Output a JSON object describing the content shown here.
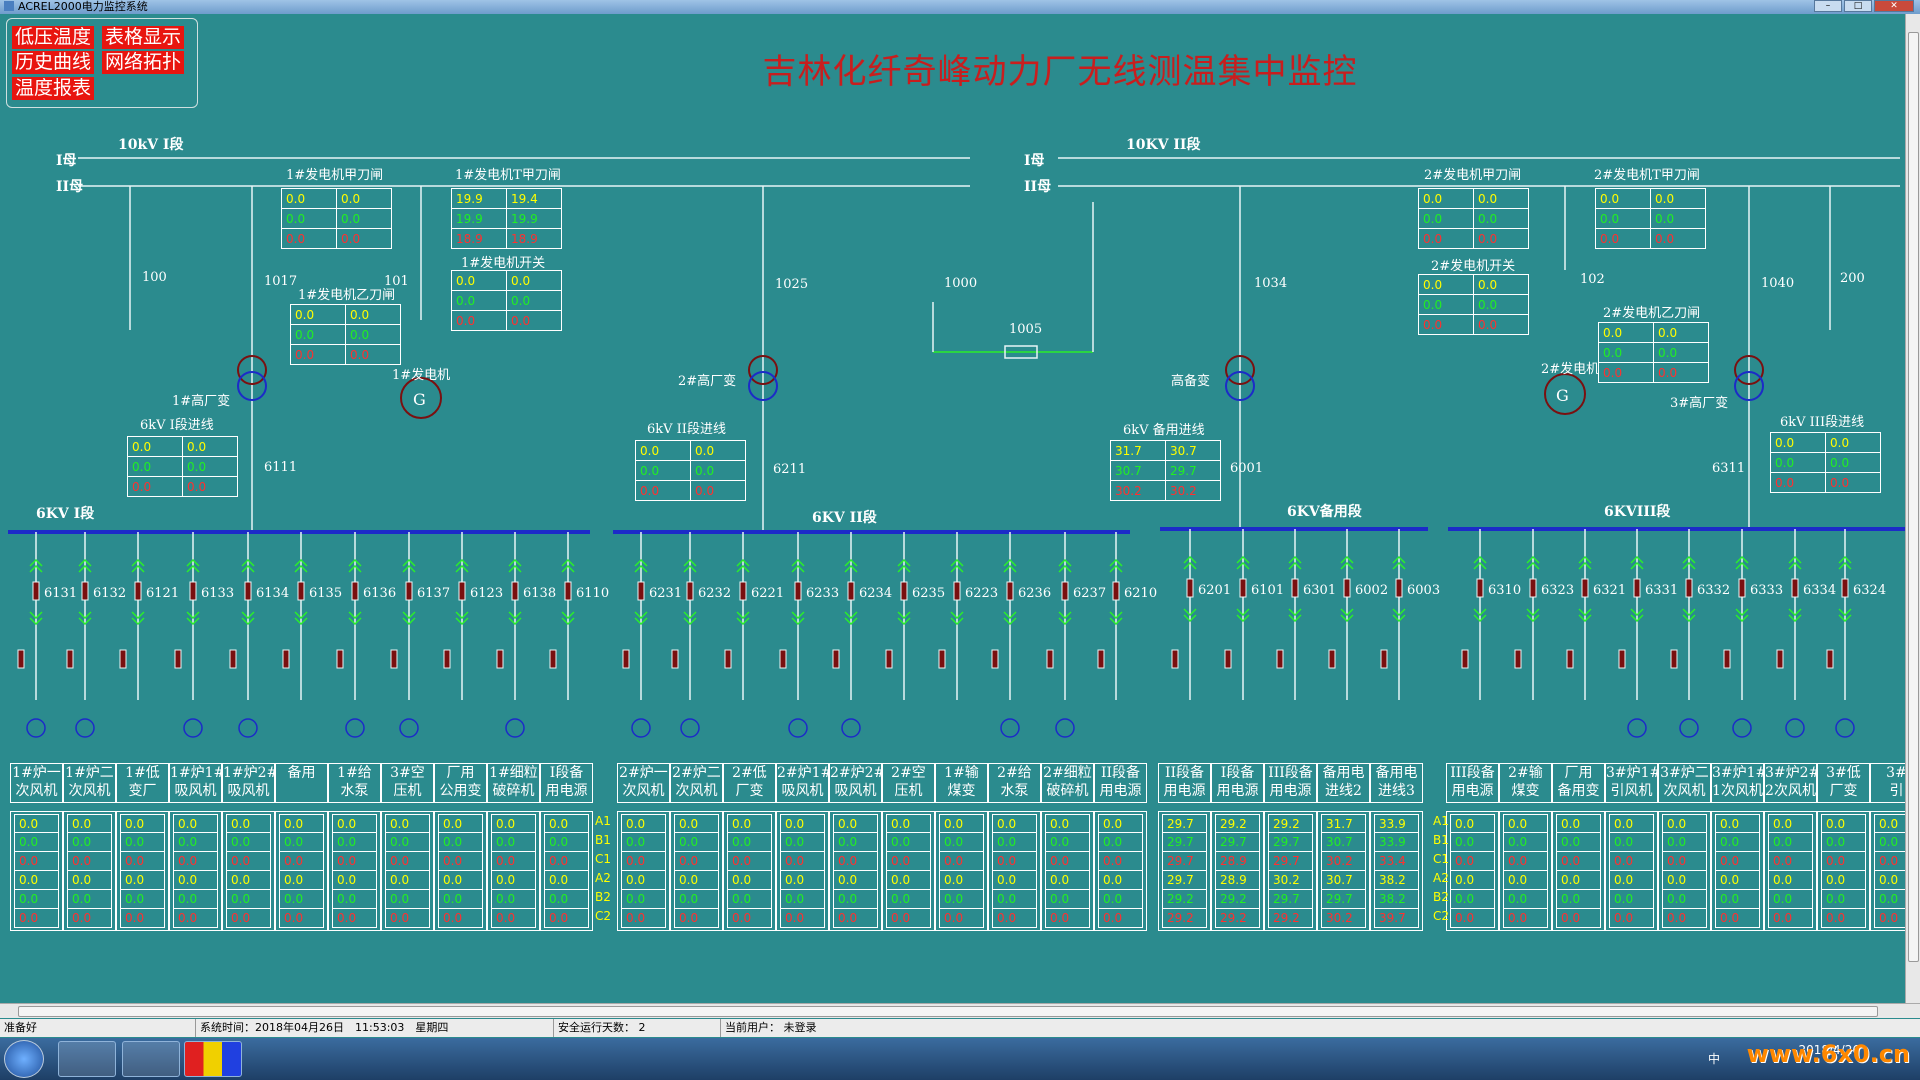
{
  "window": {
    "title": "ACREL2000电力监控系统"
  },
  "menu": {
    "btn1": "低压温度",
    "btn2": "表格显示",
    "btn3": "历史曲线",
    "btn4": "网络拓扑",
    "btn5": "温度报表"
  },
  "page_title": "吉林化纤奇峰动力厂无线测温集中监控",
  "bus": {
    "i_mu_l": "I母",
    "ii_mu_l": "II母",
    "i_mu_r": "I母",
    "ii_mu_r": "II母",
    "kv10_1": "10kV I段",
    "kv10_2": "10KV II段",
    "kv6_1": "6KV I段",
    "kv6_2": "6KV II段",
    "kv6_bk": "6KV备用段",
    "kv6_3": "6KVIII段"
  },
  "labels": {
    "gen1a": "1#发电机甲刀闸",
    "gen1t": "1#发电机T甲刀闸",
    "gen1sw": "1#发电机开关",
    "gen1b": "1#发电机乙刀闸",
    "gen1": "1#发电机",
    "hf1": "1#高厂变",
    "in6_1": "6kV I段进线",
    "hf2": "2#高厂变",
    "in6_2": "6kV II段进线",
    "gen2a": "2#发电机甲刀闸",
    "gen2t": "2#发电机T甲刀闸",
    "gen2sw": "2#发电机开关",
    "gen2b": "2#发电机乙刀闸",
    "gen2": "2#发电机",
    "hbb": "高备变",
    "in6_bk": "6kV 备用进线",
    "hf3": "3#高厂变",
    "in6_3": "6kV III段进线",
    "n100": "100",
    "n1017": "1017",
    "n101": "101",
    "n1025": "1025",
    "n1000": "1000",
    "n1005": "1005",
    "n1034": "1034",
    "n102": "102",
    "n1040": "1040",
    "n200": "200",
    "n6111": "6111",
    "n6211": "6211",
    "n6001": "6001",
    "n6311": "6311",
    "G": "G"
  },
  "tables": {
    "t_gen1a": [
      [
        "0.0",
        "0.0"
      ],
      [
        "0.0",
        "0.0"
      ],
      [
        "0.0",
        "0.0"
      ]
    ],
    "t_gen1t": [
      [
        "19.9",
        "19.4"
      ],
      [
        "19.9",
        "19.9"
      ],
      [
        "18.9",
        "18.9"
      ]
    ],
    "t_gen1sw": [
      [
        "0.0",
        "0.0"
      ],
      [
        "0.0",
        "0.0"
      ],
      [
        "0.0",
        "0.0"
      ]
    ],
    "t_gen1b": [
      [
        "0.0",
        "0.0"
      ],
      [
        "0.0",
        "0.0"
      ],
      [
        "0.0",
        "0.0"
      ]
    ],
    "t_in6_1": [
      [
        "0.0",
        "0.0"
      ],
      [
        "0.0",
        "0.0"
      ],
      [
        "0.0",
        "0.0"
      ]
    ],
    "t_in6_2": [
      [
        "0.0",
        "0.0"
      ],
      [
        "0.0",
        "0.0"
      ],
      [
        "0.0",
        "0.0"
      ]
    ],
    "t_gen2a": [
      [
        "0.0",
        "0.0"
      ],
      [
        "0.0",
        "0.0"
      ],
      [
        "0.0",
        "0.0"
      ]
    ],
    "t_gen2t": [
      [
        "0.0",
        "0.0"
      ],
      [
        "0.0",
        "0.0"
      ],
      [
        "0.0",
        "0.0"
      ]
    ],
    "t_gen2sw": [
      [
        "0.0",
        "0.0"
      ],
      [
        "0.0",
        "0.0"
      ],
      [
        "0.0",
        "0.0"
      ]
    ],
    "t_gen2b": [
      [
        "0.0",
        "0.0"
      ],
      [
        "0.0",
        "0.0"
      ],
      [
        "0.0",
        "0.0"
      ]
    ],
    "t_in6_bk": [
      [
        "31.7",
        "30.7"
      ],
      [
        "30.7",
        "29.7"
      ],
      [
        "30.2",
        "30.2"
      ]
    ],
    "t_in6_3": [
      [
        "0.0",
        "0.0"
      ],
      [
        "0.0",
        "0.0"
      ],
      [
        "0.0",
        "0.0"
      ]
    ]
  },
  "feeders": {
    "s1": [
      "6131",
      "6132",
      "6121",
      "6133",
      "6134",
      "6135",
      "6136",
      "6137",
      "6123",
      "6138",
      "6110"
    ],
    "s2": [
      "6231",
      "6232",
      "6221",
      "6233",
      "6234",
      "6235",
      "6223",
      "6236",
      "6237",
      "6210"
    ],
    "sb": [
      "6201",
      "6101",
      "6301",
      "6002",
      "6003"
    ],
    "s3": [
      "6310",
      "6323",
      "6321",
      "6331",
      "6332",
      "6333",
      "6334",
      "6324"
    ]
  },
  "phases": [
    "A1",
    "B1",
    "C1",
    "A2",
    "B2",
    "C2"
  ],
  "bottom": {
    "g1": [
      {
        "n": "1#炉一\n次风机",
        "v": [
          "0.0",
          "0.0",
          "0.0",
          "0.0",
          "0.0",
          "0.0"
        ]
      },
      {
        "n": "1#炉二\n次风机",
        "v": [
          "0.0",
          "0.0",
          "0.0",
          "0.0",
          "0.0",
          "0.0"
        ]
      },
      {
        "n": "1#低\n变厂",
        "v": [
          "0.0",
          "0.0",
          "0.0",
          "0.0",
          "0.0",
          "0.0"
        ]
      },
      {
        "n": "1#炉1#\n吸风机",
        "v": [
          "0.0",
          "0.0",
          "0.0",
          "0.0",
          "0.0",
          "0.0"
        ]
      },
      {
        "n": "1#炉2#\n吸风机",
        "v": [
          "0.0",
          "0.0",
          "0.0",
          "0.0",
          "0.0",
          "0.0"
        ]
      },
      {
        "n": "备用\n ",
        "v": [
          "0.0",
          "0.0",
          "0.0",
          "0.0",
          "0.0",
          "0.0"
        ]
      },
      {
        "n": "1#给\n水泵",
        "v": [
          "0.0",
          "0.0",
          "0.0",
          "0.0",
          "0.0",
          "0.0"
        ]
      },
      {
        "n": "3#空\n压机",
        "v": [
          "0.0",
          "0.0",
          "0.0",
          "0.0",
          "0.0",
          "0.0"
        ]
      },
      {
        "n": "厂用\n公用变",
        "v": [
          "0.0",
          "0.0",
          "0.0",
          "0.0",
          "0.0",
          "0.0"
        ]
      },
      {
        "n": "1#细粒\n破碎机",
        "v": [
          "0.0",
          "0.0",
          "0.0",
          "0.0",
          "0.0",
          "0.0"
        ]
      },
      {
        "n": "I段备\n用电源",
        "v": [
          "0.0",
          "0.0",
          "0.0",
          "0.0",
          "0.0",
          "0.0"
        ]
      }
    ],
    "g2": [
      {
        "n": "2#炉一\n次风机",
        "v": [
          "0.0",
          "0.0",
          "0.0",
          "0.0",
          "0.0",
          "0.0"
        ]
      },
      {
        "n": "2#炉二\n次风机",
        "v": [
          "0.0",
          "0.0",
          "0.0",
          "0.0",
          "0.0",
          "0.0"
        ]
      },
      {
        "n": "2#低\n厂变",
        "v": [
          "0.0",
          "0.0",
          "0.0",
          "0.0",
          "0.0",
          "0.0"
        ]
      },
      {
        "n": "2#炉1#\n吸风机",
        "v": [
          "0.0",
          "0.0",
          "0.0",
          "0.0",
          "0.0",
          "0.0"
        ]
      },
      {
        "n": "2#炉2#\n吸风机",
        "v": [
          "0.0",
          "0.0",
          "0.0",
          "0.0",
          "0.0",
          "0.0"
        ]
      },
      {
        "n": "2#空\n压机",
        "v": [
          "0.0",
          "0.0",
          "0.0",
          "0.0",
          "0.0",
          "0.0"
        ]
      },
      {
        "n": "1#输\n煤变",
        "v": [
          "0.0",
          "0.0",
          "0.0",
          "0.0",
          "0.0",
          "0.0"
        ]
      },
      {
        "n": "2#给\n水泵",
        "v": [
          "0.0",
          "0.0",
          "0.0",
          "0.0",
          "0.0",
          "0.0"
        ]
      },
      {
        "n": "2#细粒\n破碎机",
        "v": [
          "0.0",
          "0.0",
          "0.0",
          "0.0",
          "0.0",
          "0.0"
        ]
      },
      {
        "n": "II段备\n用电源",
        "v": [
          "0.0",
          "0.0",
          "0.0",
          "0.0",
          "0.0",
          "0.0"
        ]
      }
    ],
    "g3": [
      {
        "n": "II段备\n用电源",
        "v": [
          "29.7",
          "29.7",
          "29.7",
          "29.7",
          "29.2",
          "29.2"
        ]
      },
      {
        "n": "I段备\n用电源",
        "v": [
          "29.2",
          "29.7",
          "28.9",
          "28.9",
          "29.2",
          "29.2"
        ]
      },
      {
        "n": "III段备\n用电源",
        "v": [
          "29.2",
          "29.7",
          "29.7",
          "30.2",
          "29.7",
          "29.2"
        ]
      },
      {
        "n": "备用电\n进线2",
        "v": [
          "31.7",
          "30.7",
          "30.2",
          "30.7",
          "29.7",
          "30.2"
        ]
      },
      {
        "n": "备用电\n进线3",
        "v": [
          "33.9",
          "33.9",
          "33.4",
          "38.2",
          "38.2",
          "39.7"
        ]
      }
    ],
    "g4": [
      {
        "n": "III段备\n用电源",
        "v": [
          "0.0",
          "0.0",
          "0.0",
          "0.0",
          "0.0",
          "0.0"
        ]
      },
      {
        "n": "2#输\n煤变",
        "v": [
          "0.0",
          "0.0",
          "0.0",
          "0.0",
          "0.0",
          "0.0"
        ]
      },
      {
        "n": "厂用\n备用变",
        "v": [
          "0.0",
          "0.0",
          "0.0",
          "0.0",
          "0.0",
          "0.0"
        ]
      },
      {
        "n": "3#炉1#\n引风机",
        "v": [
          "0.0",
          "0.0",
          "0.0",
          "0.0",
          "0.0",
          "0.0"
        ]
      },
      {
        "n": "3#炉二\n次风机",
        "v": [
          "0.0",
          "0.0",
          "0.0",
          "0.0",
          "0.0",
          "0.0"
        ]
      },
      {
        "n": "3#炉1#\n1次风机",
        "v": [
          "0.0",
          "0.0",
          "0.0",
          "0.0",
          "0.0",
          "0.0"
        ]
      },
      {
        "n": "3#炉2#\n2次风机",
        "v": [
          "0.0",
          "0.0",
          "0.0",
          "0.0",
          "0.0",
          "0.0"
        ]
      },
      {
        "n": "3#低\n厂变",
        "v": [
          "0.0",
          "0.0",
          "0.0",
          "0.0",
          "0.0",
          "0.0"
        ]
      },
      {
        "n": "3#\n引",
        "v": [
          "0.0",
          "0.0",
          "0.0",
          "0.0",
          "0.0",
          "0.0"
        ]
      }
    ]
  },
  "status": {
    "ready": "准备好",
    "time": "系统时间：2018年04月26日　11:53:03　星期四",
    "days": "安全运行天数：  2",
    "user": "当前用户：  未登录"
  },
  "taskbar": {
    "ime": "中",
    "date": "2018/4/26"
  },
  "watermark": "www.6x0.cn",
  "colors": {
    "bus": "#1c2bc8",
    "line": "#e8f5f5",
    "switch": "#7a1010",
    "arrow": "#2aee2a"
  }
}
